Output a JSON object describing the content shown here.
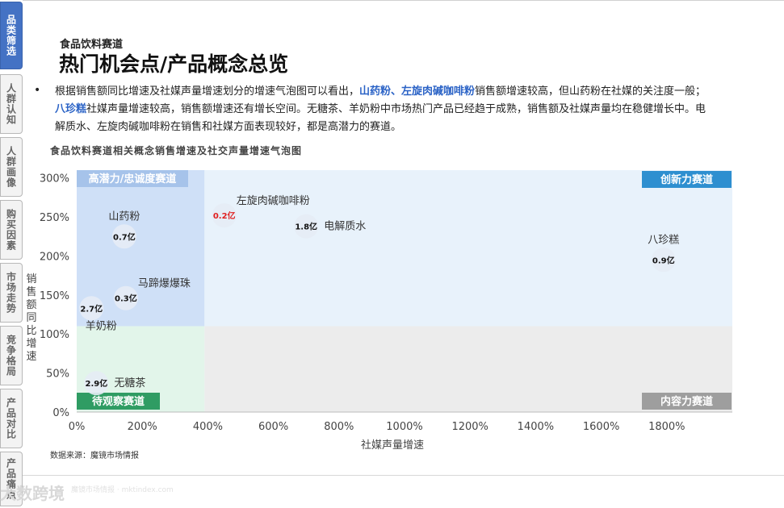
{
  "side_tabs": [
    "品类筛选",
    "人群认知",
    "人群画像",
    "购买因素",
    "市场走势",
    "竞争格局",
    "产品对比",
    "产品痛点"
  ],
  "header": {
    "subtitle": "食品饮料赛道",
    "title": "热门机会点/产品概念总览"
  },
  "paragraph": {
    "line1_a": "根据销售额同比增速及社媒声量增速划分的增速气泡图可以看出，",
    "line1_hl": "山药粉、左旋肉碱咖啡粉",
    "line1_b": "销售额增速较高，但山药粉在社媒的关注度一般；",
    "line2_hl": "八珍糕",
    "line2_b": "社媒声量增速较高，销售额增速还有增长空间。无糖茶、羊奶粉中市场热门产品已经趋于成熟，销售额及社媒声量均在稳健增长中。电",
    "line3": "解质水、左旋肉碱咖啡粉在销售和社媒方面表现较好，都是高潜力的赛道。"
  },
  "chart_title": "食品饮料赛道相关概念销售增速及社交声量增速气泡图",
  "source": "数据来源：魔镜市场情报",
  "watermark": "大数跨境",
  "watermark_small": "魔镜市场情报 · mktindex.com",
  "chart_data": {
    "type": "scatter",
    "xlabel": "社媒声量增速",
    "ylabel": "销售额同比增速",
    "xlim": [
      0,
      2000
    ],
    "ylim": [
      0,
      310
    ],
    "x_ticks": [
      0,
      200,
      400,
      600,
      800,
      1000,
      1200,
      1400,
      1600,
      1800
    ],
    "y_ticks": [
      0,
      50,
      100,
      150,
      200,
      250,
      300
    ],
    "tick_suffix": "%",
    "x_split": 390,
    "y_split": 110,
    "quadrants": {
      "top_left": "高潜力/忠诚度赛道",
      "top_right": "创新力赛道",
      "bottom_left": "待观察赛道",
      "bottom_right": "内容力赛道"
    },
    "colors": {
      "top_left": "#cfe0f7",
      "top_right": "#e8f2fb",
      "bottom_left": "#e2f5ea",
      "bottom_right": "#ececec",
      "label_blue": "#2e8fd0",
      "label_gray": "#9e9e9e",
      "label_green": "#2f9c63",
      "label_lightblue": "#a6c3ea",
      "highlight_red": "#e02020"
    },
    "points": [
      {
        "name": "山药粉",
        "x": 145,
        "y": 225,
        "value_label": "0.7亿",
        "name_pos": "above"
      },
      {
        "name": "左旋肉碱咖啡粉",
        "x": 450,
        "y": 252,
        "value_label": "0.2亿",
        "name_pos": "right-above",
        "highlight": true
      },
      {
        "name": "电解质水",
        "x": 700,
        "y": 238,
        "value_label": "1.8亿",
        "name_pos": "right"
      },
      {
        "name": "八珍糕",
        "x": 1790,
        "y": 195,
        "value_label": "0.9亿",
        "name_pos": "above"
      },
      {
        "name": "马蹄爆爆珠",
        "x": 150,
        "y": 146,
        "value_label": "0.3亿",
        "name_pos": "right-above"
      },
      {
        "name": "羊奶粉",
        "x": 45,
        "y": 133,
        "value_label": "2.7亿",
        "name_pos": "below"
      },
      {
        "name": "无糖茶",
        "x": 60,
        "y": 37,
        "value_label": "2.9亿",
        "name_pos": "right"
      }
    ]
  }
}
